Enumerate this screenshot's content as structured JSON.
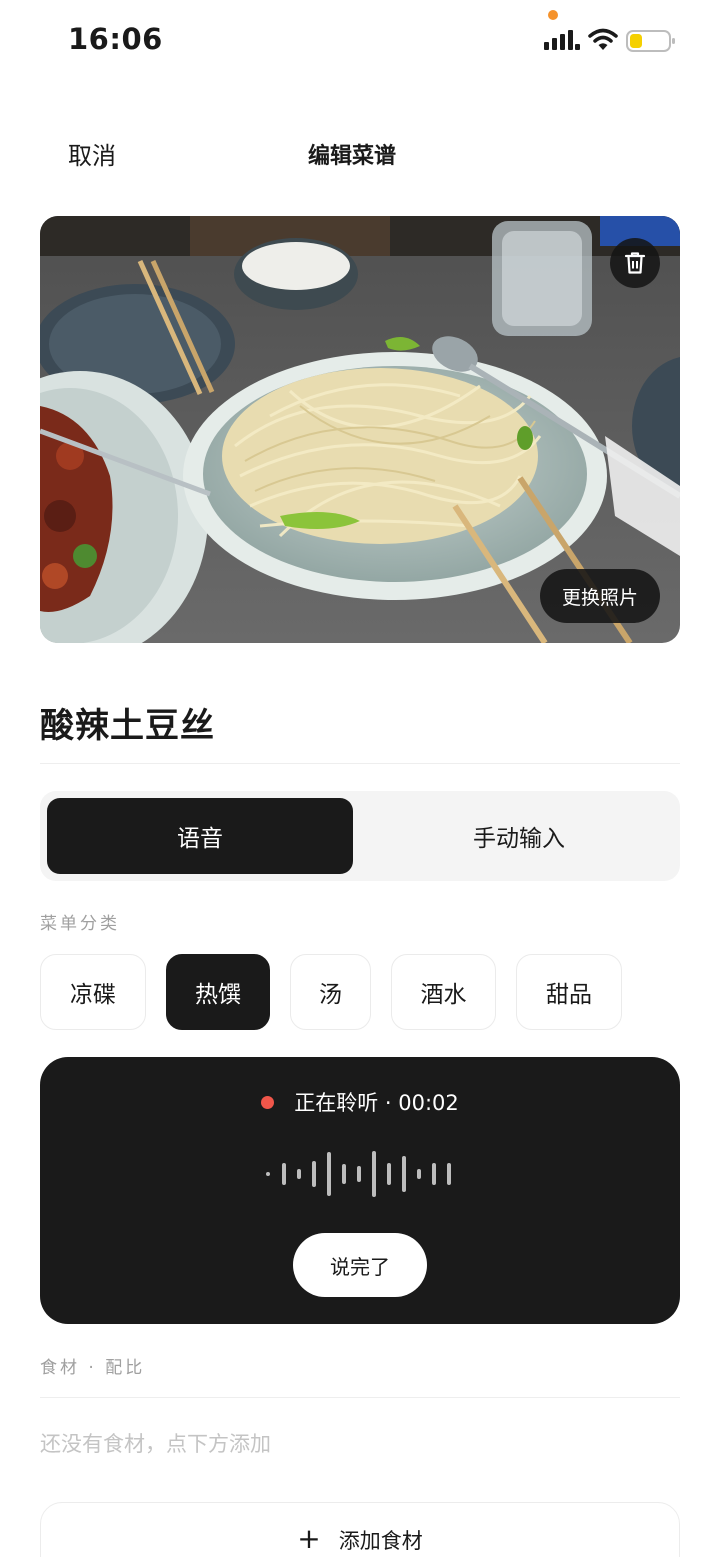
{
  "status_bar": {
    "time": "16:06"
  },
  "nav": {
    "cancel_label": "取消",
    "title": "编辑菜谱"
  },
  "photo": {
    "change_label": "更换照片"
  },
  "dish": {
    "name": "酸辣土豆丝"
  },
  "input_mode": {
    "options": [
      "语音",
      "手动输入"
    ],
    "selected": "语音"
  },
  "category": {
    "label": "菜单分类",
    "options": [
      "凉碟",
      "热馔",
      "汤",
      "酒水",
      "甜品"
    ],
    "selected": "热馔"
  },
  "voice": {
    "status": "正在聆听 · 00:02",
    "done_label": "说完了"
  },
  "ingredients": {
    "label": "食材 · 配比",
    "empty_hint": "还没有食材，点下方添加",
    "add_label": "添加食材"
  },
  "colors": {
    "accent": "#1a1a1a",
    "recording": "#f0564a",
    "privacy": "#f5922b",
    "battery": "#f5d000"
  }
}
